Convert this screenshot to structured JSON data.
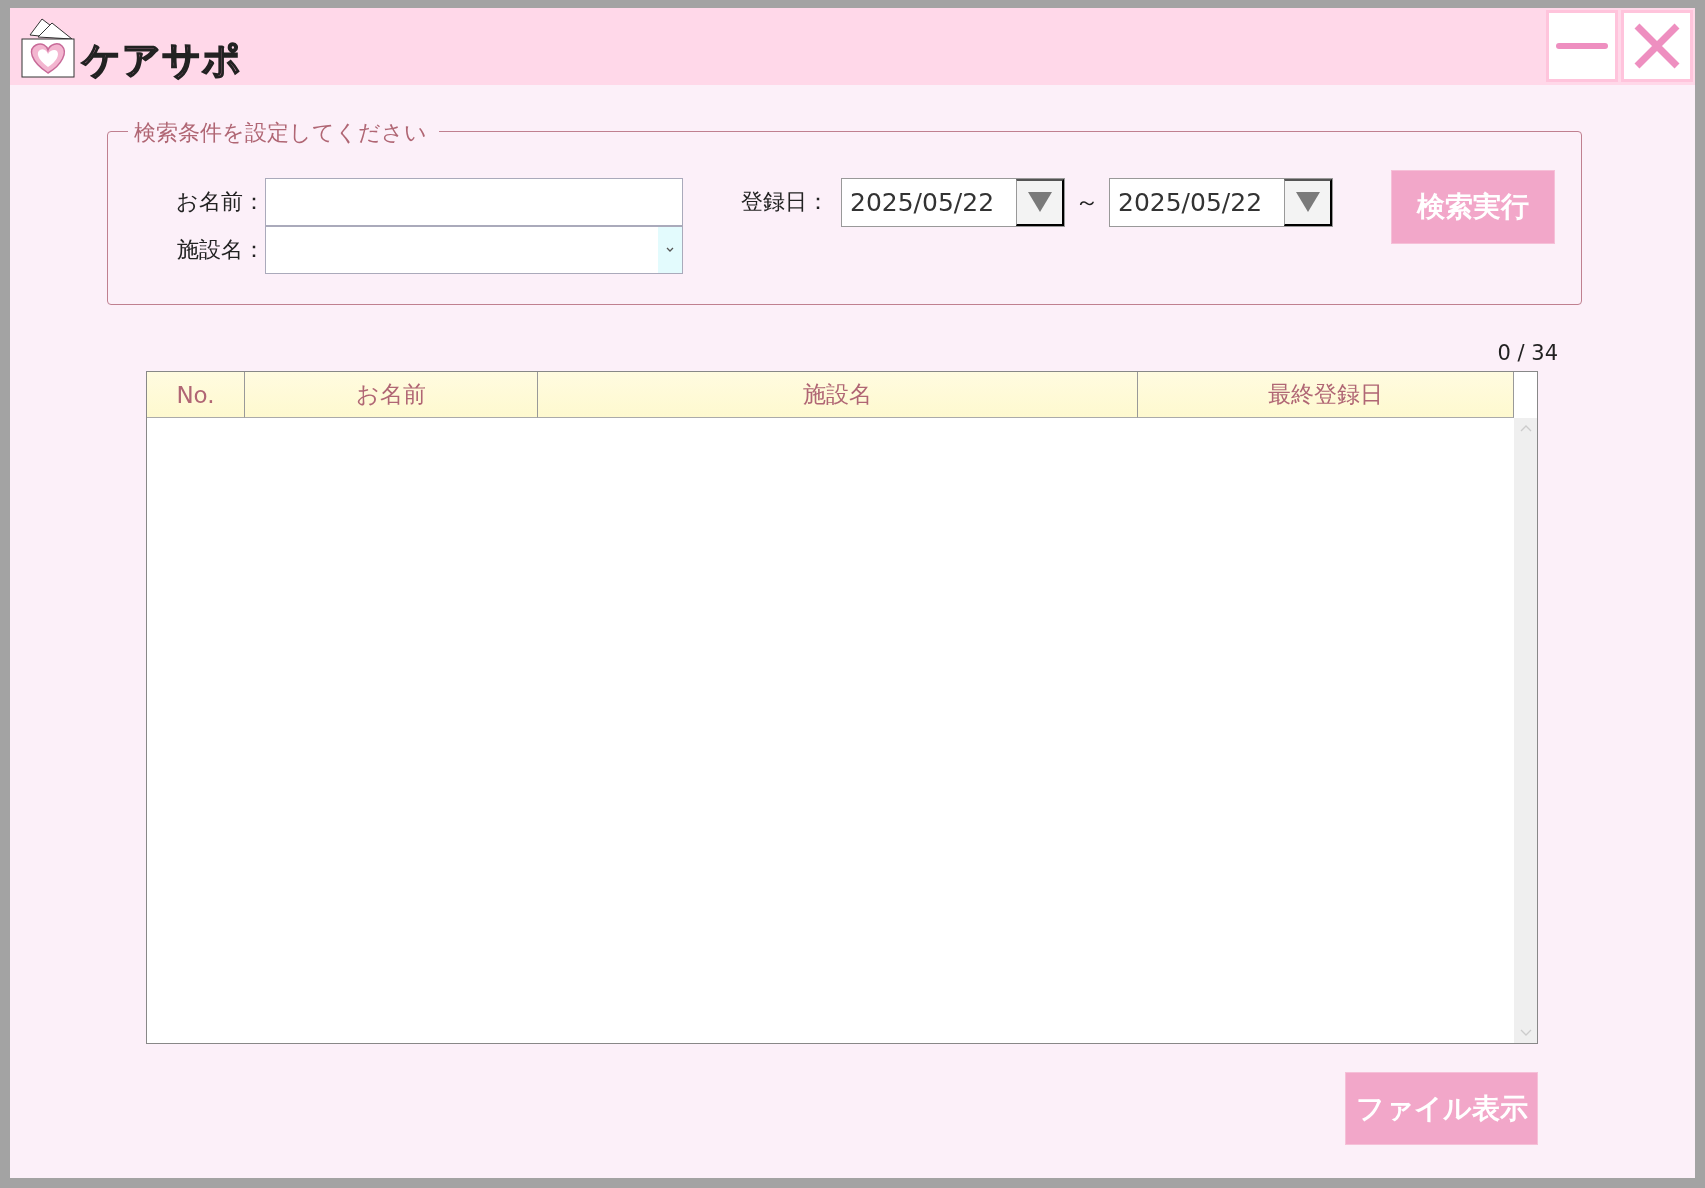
{
  "window": {
    "logo_text": "ケアサポ"
  },
  "search": {
    "legend": "検索条件を設定してください",
    "name_label": "お名前：",
    "facility_label": "施設名：",
    "date_label": "登録日：",
    "date_from": "2025/05/22",
    "range_separator": "～",
    "date_to": "2025/05/22",
    "button": "検索実行"
  },
  "count": "0 / 34",
  "table": {
    "columns": [
      "No.",
      "お名前",
      "施設名",
      "最終登録日"
    ]
  },
  "file_button": "ファイル表示"
}
